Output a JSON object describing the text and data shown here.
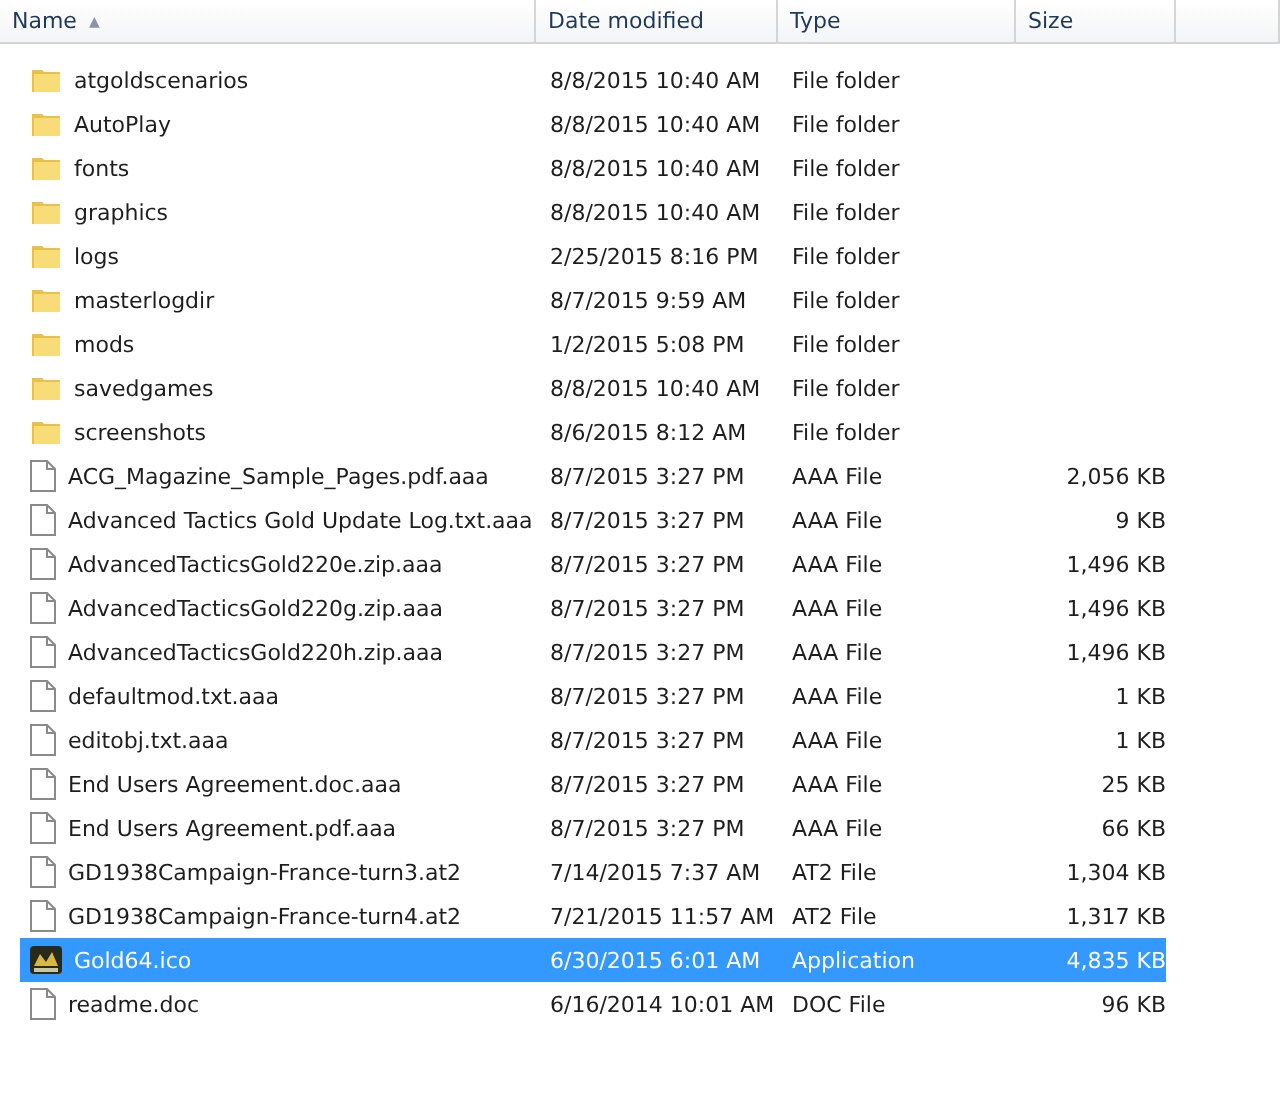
{
  "columns": [
    {
      "label": "Name",
      "sorted": true
    },
    {
      "label": "Date modified",
      "sorted": false
    },
    {
      "label": "Type",
      "sorted": false
    },
    {
      "label": "Size",
      "sorted": false
    }
  ],
  "sort_arrow": "▲",
  "rows": [
    {
      "kind": "folder",
      "name": "atgoldscenarios",
      "date": "8/8/2015 10:40 AM",
      "type": "File folder",
      "selected": false
    },
    {
      "kind": "folder",
      "name": "AutoPlay",
      "date": "8/8/2015 10:40 AM",
      "type": "File folder",
      "selected": false
    },
    {
      "kind": "folder",
      "name": "fonts",
      "date": "8/8/2015 10:40 AM",
      "type": "File folder",
      "selected": false
    },
    {
      "kind": "folder",
      "name": "graphics",
      "date": "8/8/2015 10:40 AM",
      "type": "File folder",
      "selected": false
    },
    {
      "kind": "folder",
      "name": "logs",
      "date": "2/25/2015 8:16 PM",
      "type": "File folder",
      "selected": false
    },
    {
      "kind": "folder",
      "name": "masterlogdir",
      "date": "8/7/2015 9:59 AM",
      "type": "File folder",
      "selected": false
    },
    {
      "kind": "folder",
      "name": "mods",
      "date": "1/2/2015 5:08 PM",
      "type": "File folder",
      "selected": false
    },
    {
      "kind": "folder",
      "name": "savedgames",
      "date": "8/8/2015 10:40 AM",
      "type": "File folder",
      "selected": false
    },
    {
      "kind": "folder",
      "name": "screenshots",
      "date": "8/6/2015 8:12 AM",
      "type": "File folder",
      "selected": false
    },
    {
      "kind": "file",
      "name": "ACG_Magazine_Sample_Pages.pdf.aaa",
      "date": "8/7/2015 3:27 PM",
      "type": "AAA File",
      "size": "2,056 KB",
      "selected": false
    },
    {
      "kind": "file",
      "name": "Advanced Tactics Gold Update Log.txt.aaa",
      "date": "8/7/2015 3:27 PM",
      "type": "AAA File",
      "size": "9 KB",
      "selected": false
    },
    {
      "kind": "file",
      "name": "AdvancedTacticsGold220e.zip.aaa",
      "date": "8/7/2015 3:27 PM",
      "type": "AAA File",
      "size": "1,496 KB",
      "selected": false
    },
    {
      "kind": "file",
      "name": "AdvancedTacticsGold220g.zip.aaa",
      "date": "8/7/2015 3:27 PM",
      "type": "AAA File",
      "size": "1,496 KB",
      "selected": false
    },
    {
      "kind": "file",
      "name": "AdvancedTacticsGold220h.zip.aaa",
      "date": "8/7/2015 3:27 PM",
      "type": "AAA File",
      "size": "1,496 KB",
      "selected": false
    },
    {
      "kind": "file",
      "name": "defaultmod.txt.aaa",
      "date": "8/7/2015 3:27 PM",
      "type": "AAA File",
      "size": "1 KB",
      "selected": false
    },
    {
      "kind": "file",
      "name": "editobj.txt.aaa",
      "date": "8/7/2015 3:27 PM",
      "type": "AAA File",
      "size": "1 KB",
      "selected": false
    },
    {
      "kind": "file",
      "name": "End Users Agreement.doc.aaa",
      "date": "8/7/2015 3:27 PM",
      "type": "AAA File",
      "size": "25 KB",
      "selected": false
    },
    {
      "kind": "file",
      "name": "End Users Agreement.pdf.aaa",
      "date": "8/7/2015 3:27 PM",
      "type": "AAA File",
      "size": "66 KB",
      "selected": false
    },
    {
      "kind": "file",
      "name": "GD1938Campaign-France-turn3.at2",
      "date": "7/14/2015 7:37 AM",
      "type": "AT2 File",
      "size": "1,304 KB",
      "selected": false
    },
    {
      "kind": "file",
      "name": "GD1938Campaign-France-turn4.at2",
      "date": "7/21/2015 11:57 AM",
      "type": "AT2 File",
      "size": "1,317 KB",
      "selected": false
    },
    {
      "kind": "app",
      "name": "Gold64.ico",
      "date": "6/30/2015 6:01 AM",
      "type": "Application",
      "size": "4,835 KB",
      "selected": true
    },
    {
      "kind": "file",
      "name": "readme.doc",
      "date": "6/16/2014 10:01 AM",
      "type": "DOC File",
      "size": "96 KB",
      "selected": false
    }
  ]
}
